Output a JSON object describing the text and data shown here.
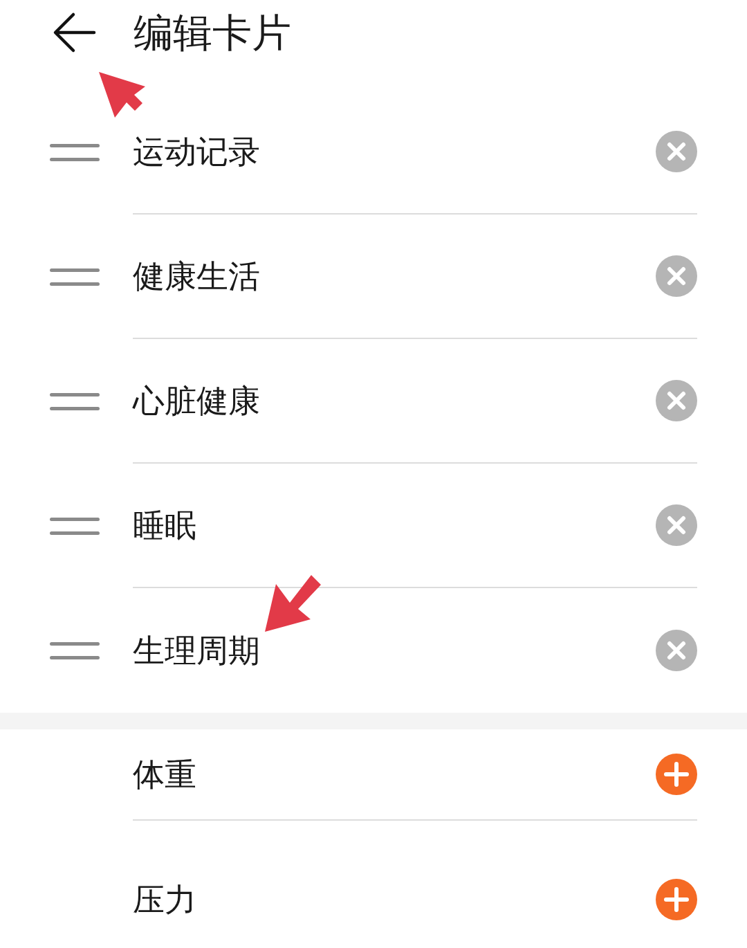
{
  "header": {
    "title": "编辑卡片"
  },
  "shown_cards": [
    {
      "label": "运动记录"
    },
    {
      "label": "健康生活"
    },
    {
      "label": "心脏健康"
    },
    {
      "label": "睡眠"
    },
    {
      "label": "生理周期"
    }
  ],
  "more_cards": [
    {
      "label": "体重"
    },
    {
      "label": "压力"
    }
  ]
}
